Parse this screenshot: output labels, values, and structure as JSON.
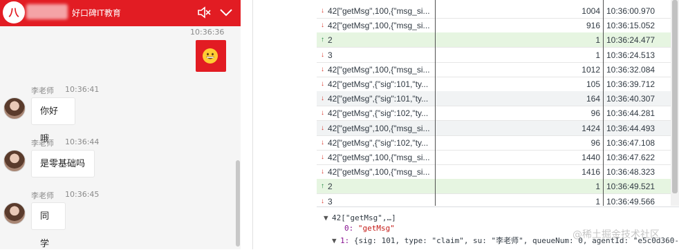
{
  "chat": {
    "logo_text": "八",
    "brand": "好口碑IT教育",
    "sent_time": "10:36:36",
    "messages": [
      {
        "sender": "李老师",
        "time": "10:36:41",
        "text": "你好哦"
      },
      {
        "sender": "李老师",
        "time": "10:36:44",
        "text": "是零基础吗"
      },
      {
        "sender": "李老师",
        "time": "10:36:45",
        "text": "同学"
      }
    ]
  },
  "network": {
    "rows": [
      {
        "dir": "down",
        "data": "42[\"getMsg\",100,{\"msg_si...",
        "length": "1004",
        "time": "10:36:00.970",
        "shade": "none"
      },
      {
        "dir": "down",
        "data": "42[\"getMsg\",100,{\"msg_si...",
        "length": "916",
        "time": "10:36:15.052",
        "shade": "none"
      },
      {
        "dir": "up",
        "data": "2",
        "length": "1",
        "time": "10:36:24.477",
        "shade": "green"
      },
      {
        "dir": "down",
        "data": "3",
        "length": "1",
        "time": "10:36:24.513",
        "shade": "none"
      },
      {
        "dir": "down",
        "data": "42[\"getMsg\",100,{\"msg_si...",
        "length": "1012",
        "time": "10:36:32.084",
        "shade": "none"
      },
      {
        "dir": "down",
        "data": "42[\"getMsg\",{\"sig\":101,\"ty...",
        "length": "105",
        "time": "10:36:39.712",
        "shade": "none"
      },
      {
        "dir": "down",
        "data": "42[\"getMsg\",{\"sig\":101,\"ty...",
        "length": "164",
        "time": "10:36:40.307",
        "shade": "gray"
      },
      {
        "dir": "down",
        "data": "42[\"getMsg\",{\"sig\":102,\"ty...",
        "length": "96",
        "time": "10:36:44.281",
        "shade": "none"
      },
      {
        "dir": "down",
        "data": "42[\"getMsg\",100,{\"msg_si...",
        "length": "1424",
        "time": "10:36:44.493",
        "shade": "gray"
      },
      {
        "dir": "down",
        "data": "42[\"getMsg\",{\"sig\":102,\"ty...",
        "length": "96",
        "time": "10:36:47.108",
        "shade": "none"
      },
      {
        "dir": "down",
        "data": "42[\"getMsg\",100,{\"msg_si...",
        "length": "1440",
        "time": "10:36:47.622",
        "shade": "none"
      },
      {
        "dir": "down",
        "data": "42[\"getMsg\",100,{\"msg_si...",
        "length": "1416",
        "time": "10:36:48.323",
        "shade": "none"
      },
      {
        "dir": "up",
        "data": "2",
        "length": "1",
        "time": "10:36:49.521",
        "shade": "green"
      },
      {
        "dir": "down",
        "data": "3",
        "length": "1",
        "time": "10:36:49.566",
        "shade": "none"
      }
    ]
  },
  "detail": {
    "root": "42[\"getMsg\",…]",
    "item0_key": "0:",
    "item0_val": "\"getMsg\"",
    "item1_key": "1:",
    "item1_val": "{sig: 101, type: \"claim\", su: \"李老师\", queueNum: 0, agentId: \"e5c0d360-"
  },
  "watermark": "@稀土掘金技术社区",
  "colors": {
    "brand_red": "#e21c23",
    "sent_green": "#e6f5e1"
  }
}
